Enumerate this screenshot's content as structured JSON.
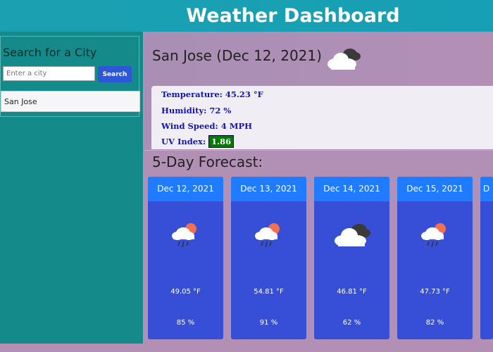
{
  "header": {
    "title": "Weather Dashboard"
  },
  "sidebar": {
    "search_title": "Search for a City",
    "search_placeholder": "Enter a city",
    "search_button": "Search",
    "history": [
      "San Jose"
    ]
  },
  "current": {
    "city_title": "San Jose (Dec 12, 2021)",
    "icon": "cloudy-icon",
    "temperature_label": "Temperature: 45.23 °F",
    "humidity_label": "Humidity: 72 %",
    "wind_label": "Wind Speed: 4 MPH",
    "uv_label": "UV Index:",
    "uv_value": "1.86",
    "uv_color": "#007a00"
  },
  "forecast": {
    "title": "5-Day Forecast:",
    "days": [
      {
        "date": "Dec 12, 2021",
        "icon": "rain-sun-icon",
        "temp": "49.05 °F",
        "humidity": "85 %"
      },
      {
        "date": "Dec 13, 2021",
        "icon": "rain-sun-icon",
        "temp": "54.81 °F",
        "humidity": "91 %"
      },
      {
        "date": "Dec 14, 2021",
        "icon": "cloudy-icon",
        "temp": "46.81 °F",
        "humidity": "62 %"
      },
      {
        "date": "Dec 15, 2021",
        "icon": "rain-sun-icon",
        "temp": "47.73 °F",
        "humidity": "82 %"
      },
      {
        "date": "D",
        "icon": "",
        "temp": "",
        "humidity": ""
      }
    ]
  },
  "colors": {
    "header": "#179fb5",
    "sidebar": "#148a8a",
    "card": "#364fd6",
    "card_header": "#1f7bff"
  }
}
